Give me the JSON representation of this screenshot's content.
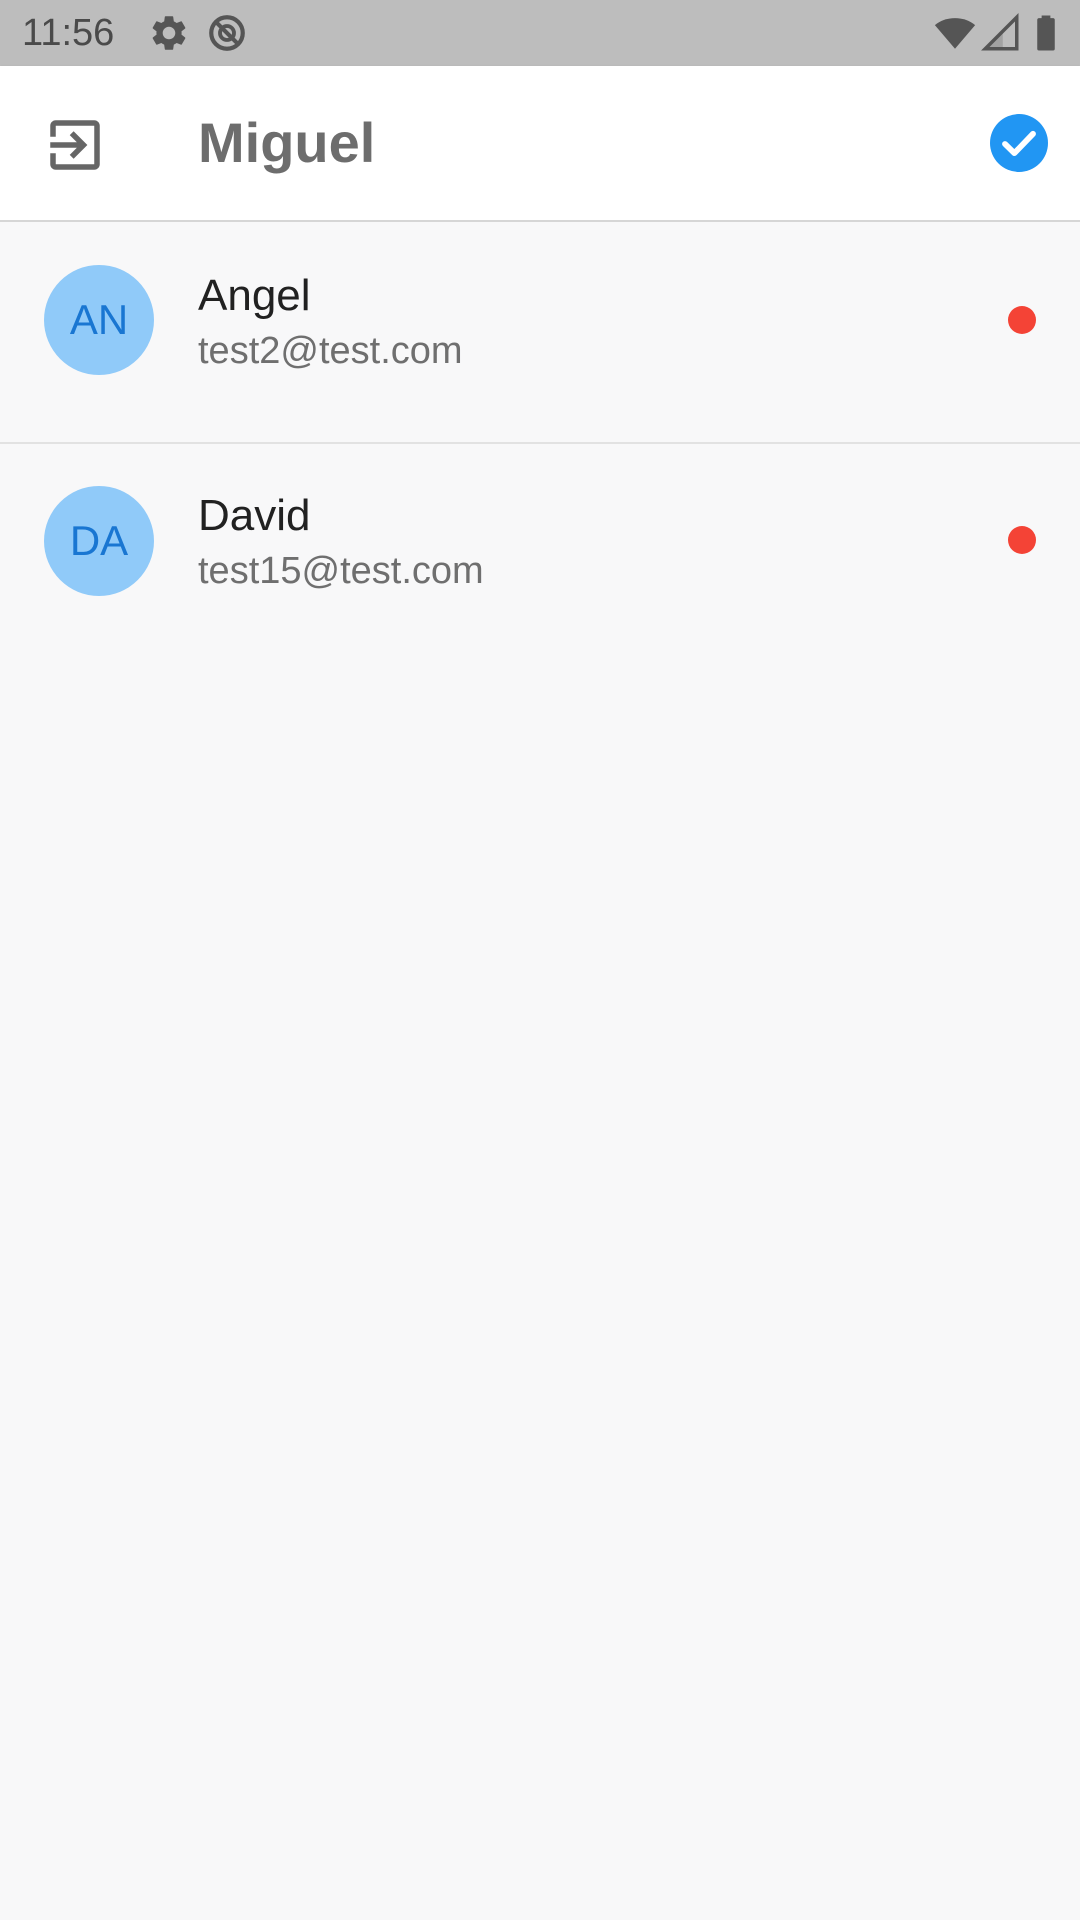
{
  "status_bar": {
    "time": "11:56",
    "icons": [
      "settings-icon",
      "do-not-disturb-icon",
      "wifi-icon",
      "signal-icon",
      "battery-icon"
    ]
  },
  "app_bar": {
    "title": "Miguel",
    "left_icon": "logout-icon",
    "right_icon": "check-circle-icon",
    "accent_color": "#2196f3"
  },
  "contacts": [
    {
      "initials": "AN",
      "name": "Angel",
      "email": "test2@test.com",
      "status_color": "#f44336"
    },
    {
      "initials": "DA",
      "name": "David",
      "email": "test15@test.com",
      "status_color": "#f44336"
    }
  ],
  "colors": {
    "avatar_bg": "#90caf9",
    "avatar_text": "#1976d2",
    "status_bar_bg": "#bdbdbd"
  }
}
